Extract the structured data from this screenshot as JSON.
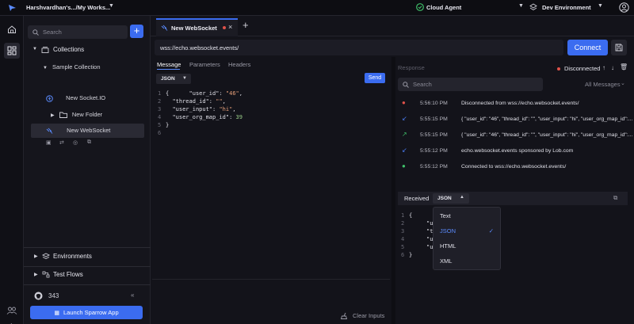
{
  "topbar": {
    "workspace": "Harshvardhan's.../My Works...",
    "agent": "Cloud Agent",
    "environment": "Dev Environment"
  },
  "sidebar": {
    "search_placeholder": "Search",
    "collections_label": "Collections",
    "tree": [
      {
        "label": "Sample Collection"
      },
      {
        "label": "New Socket.IO"
      },
      {
        "label": "New Folder"
      },
      {
        "label": "New WebSocket"
      }
    ],
    "environments_label": "Environments",
    "test_flows_label": "Test Flows",
    "github_count": "343",
    "launch_label": "Launch Sparrow App"
  },
  "tab": {
    "label": "New WebSocket"
  },
  "url": {
    "value": "wss://echo.websocket.events/"
  },
  "connect_label": "Connect",
  "message_panel": {
    "tabs": [
      "Message",
      "Parameters",
      "Headers"
    ],
    "format": "JSON",
    "send_label": "Send",
    "clear_inputs_label": "Clear Inputs",
    "code": [
      {
        "n": "1",
        "parts": [
          [
            "p",
            "{      "
          ],
          [
            "k",
            "\"user_id\""
          ],
          [
            "p",
            ": "
          ],
          [
            "s",
            "\"46\""
          ],
          [
            "p",
            ","
          ]
        ]
      },
      {
        "n": "2",
        "parts": [
          [
            "p",
            "  "
          ],
          [
            "k",
            "\"thread_id\""
          ],
          [
            "p",
            ": "
          ],
          [
            "s",
            "\"\""
          ],
          [
            "p",
            ","
          ]
        ]
      },
      {
        "n": "3",
        "parts": [
          [
            "p",
            "  "
          ],
          [
            "k",
            "\"user_input\""
          ],
          [
            "p",
            ": "
          ],
          [
            "s",
            "\"hi\""
          ],
          [
            "p",
            ","
          ]
        ]
      },
      {
        "n": "4",
        "parts": [
          [
            "p",
            "  "
          ],
          [
            "k",
            "\"user_org_map_id\""
          ],
          [
            "p",
            ": "
          ],
          [
            "num",
            "39"
          ]
        ]
      },
      {
        "n": "5",
        "parts": [
          [
            "p",
            "}"
          ]
        ]
      },
      {
        "n": "6",
        "parts": []
      }
    ]
  },
  "response": {
    "title": "Response",
    "status": "Disconnected",
    "search_placeholder": "Search",
    "filter": "All Messages",
    "logs": [
      {
        "icon": "error",
        "time": "5:56:10 PM",
        "text": "Disconnected from wss://echo.websocket.events/"
      },
      {
        "icon": "received",
        "time": "5:55:15 PM",
        "text": "{ \"user_id\": \"46\", \"thread_id\": \"\", \"user_input\": \"hi\", \"user_org_map_id\":..."
      },
      {
        "icon": "sent",
        "time": "5:55:15 PM",
        "text": "{ \"user_id\": \"46\", \"thread_id\": \"\", \"user_input\": \"hi\", \"user_org_map_id\":..."
      },
      {
        "icon": "received",
        "time": "5:55:12 PM",
        "text": "echo.websocket.events sponsored by Lob.com"
      },
      {
        "icon": "success",
        "time": "5:55:12 PM",
        "text": "Connected to wss://echo.websocket.events/"
      }
    ],
    "colors": {
      "error": "#e0524a",
      "received": "#4a7cf2",
      "sent": "#3fbf6a",
      "success": "#3fbf6a"
    }
  },
  "received": {
    "label": "Received",
    "format": "JSON",
    "options": [
      "Text",
      "JSON",
      "HTML",
      "XML"
    ],
    "selected": "JSON",
    "line_numbers": [
      "1",
      "2",
      "3",
      "4",
      "5",
      "6"
    ],
    "line_fragments": [
      "{",
      "\"u",
      "\"th",
      "\"u",
      "\"u",
      "}"
    ]
  }
}
